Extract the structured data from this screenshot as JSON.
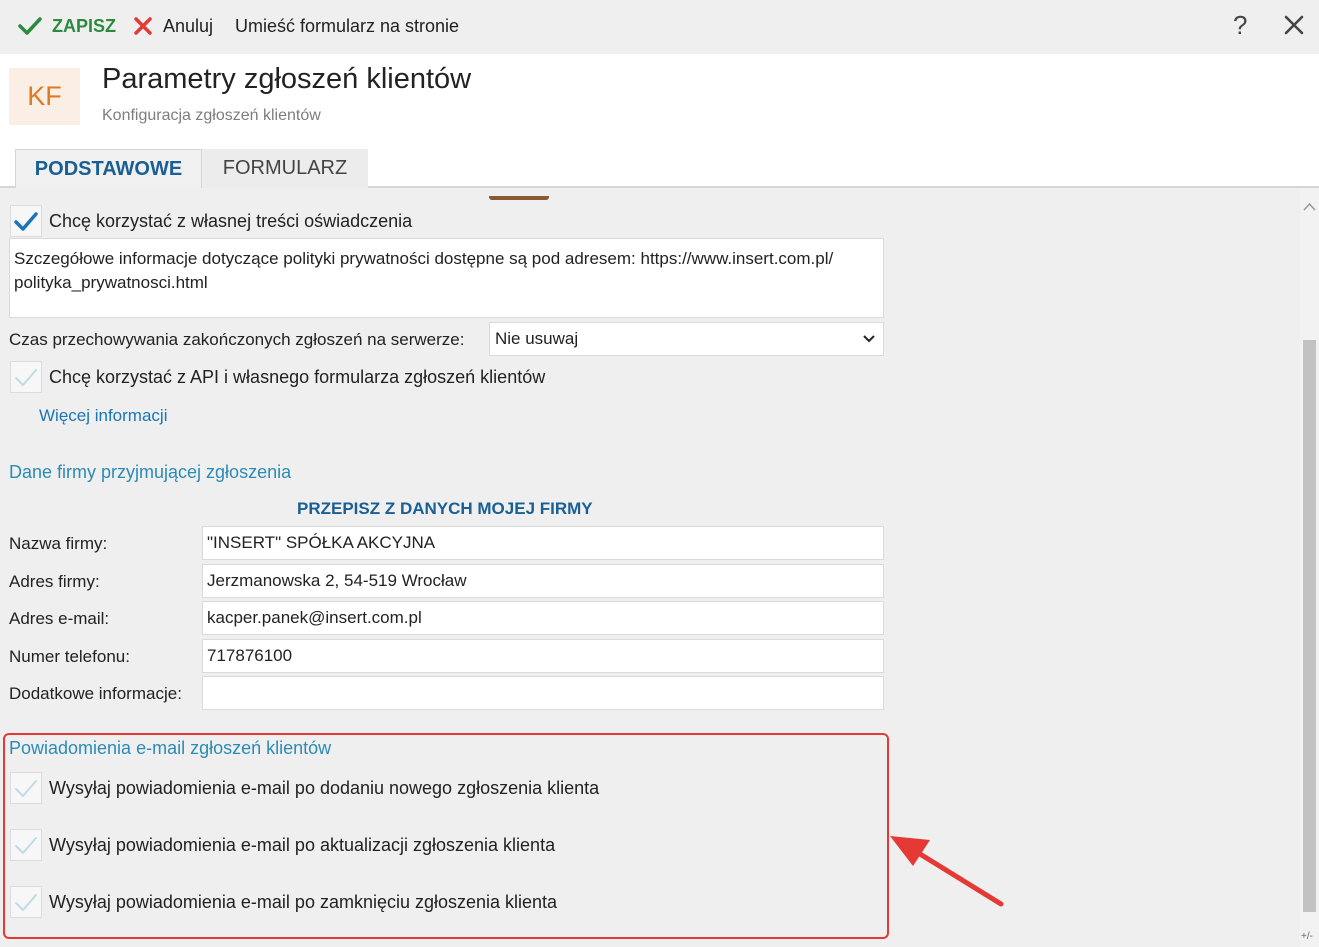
{
  "toolbar": {
    "save_label": "ZAPISZ",
    "cancel_label": "Anuluj",
    "place_form_label": "Umieść formularz na stronie",
    "help_label": "?"
  },
  "header": {
    "logo_text": "KF",
    "title": "Parametry zgłoszeń klientów",
    "subtitle": "Konfiguracja zgłoszeń klientów"
  },
  "tabs": [
    {
      "label": "PODSTAWOWE",
      "active": true
    },
    {
      "label": "FORMULARZ",
      "active": false
    }
  ],
  "consent": {
    "checkbox_label": "Chcę korzystać z własnej treści oświadczenia",
    "checked": true,
    "text_line1": "Szczegółowe informacje dotyczące polityki prywatności dostępne są pod adresem: https://www.insert.com.pl/",
    "text_line2": "polityka_prywatnosci.html"
  },
  "storage": {
    "label": "Czas przechowywania zakończonych zgłoszeń na serwerze:",
    "value": "Nie usuwaj"
  },
  "api": {
    "checkbox_label": "Chcę korzystać z API i własnego formularza zgłoszeń klientów",
    "checked": false,
    "more_info_link": "Więcej informacji"
  },
  "company": {
    "section_title": "Dane firmy przyjmującej zgłoszenia",
    "copy_action": "PRZEPISZ Z DANYCH MOJEJ FIRMY",
    "fields": [
      {
        "label": "Nazwa firmy:",
        "value": "\"INSERT\" SPÓŁKA AKCYJNA"
      },
      {
        "label": "Adres firmy:",
        "value": "Jerzmanowska 2, 54-519 Wrocław"
      },
      {
        "label": "Adres e-mail:",
        "value": "kacper.panek@insert.com.pl"
      },
      {
        "label": "Numer telefonu:",
        "value": "717876100"
      },
      {
        "label": "Dodatkowe informacje:",
        "value": ""
      }
    ]
  },
  "notifications": {
    "section_title": "Powiadomienia e-mail zgłoszeń klientów",
    "items": [
      {
        "label": "Wysyłaj powiadomienia e-mail po dodaniu nowego zgłoszenia klienta",
        "checked": false
      },
      {
        "label": "Wysyłaj powiadomienia e-mail po aktualizacji zgłoszenia klienta",
        "checked": false
      },
      {
        "label": "Wysyłaj powiadomienia e-mail po zamknięciu zgłoszenia klienta",
        "checked": false
      }
    ]
  },
  "scrollbar": {
    "corner_label": "+/-"
  },
  "colors": {
    "accent_blue": "#1a5f94",
    "section_blue": "#2b8bb6",
    "save_green": "#2b8a3e",
    "cancel_red": "#e53935",
    "highlight_red": "#e53935",
    "logo_orange": "#e07a22"
  },
  "icons": {
    "save": "check-icon",
    "cancel": "x-icon",
    "close": "close-icon",
    "select": "chevron-down-icon",
    "scroll_up": "chevron-up-icon",
    "annotation": "red-arrow-icon"
  }
}
